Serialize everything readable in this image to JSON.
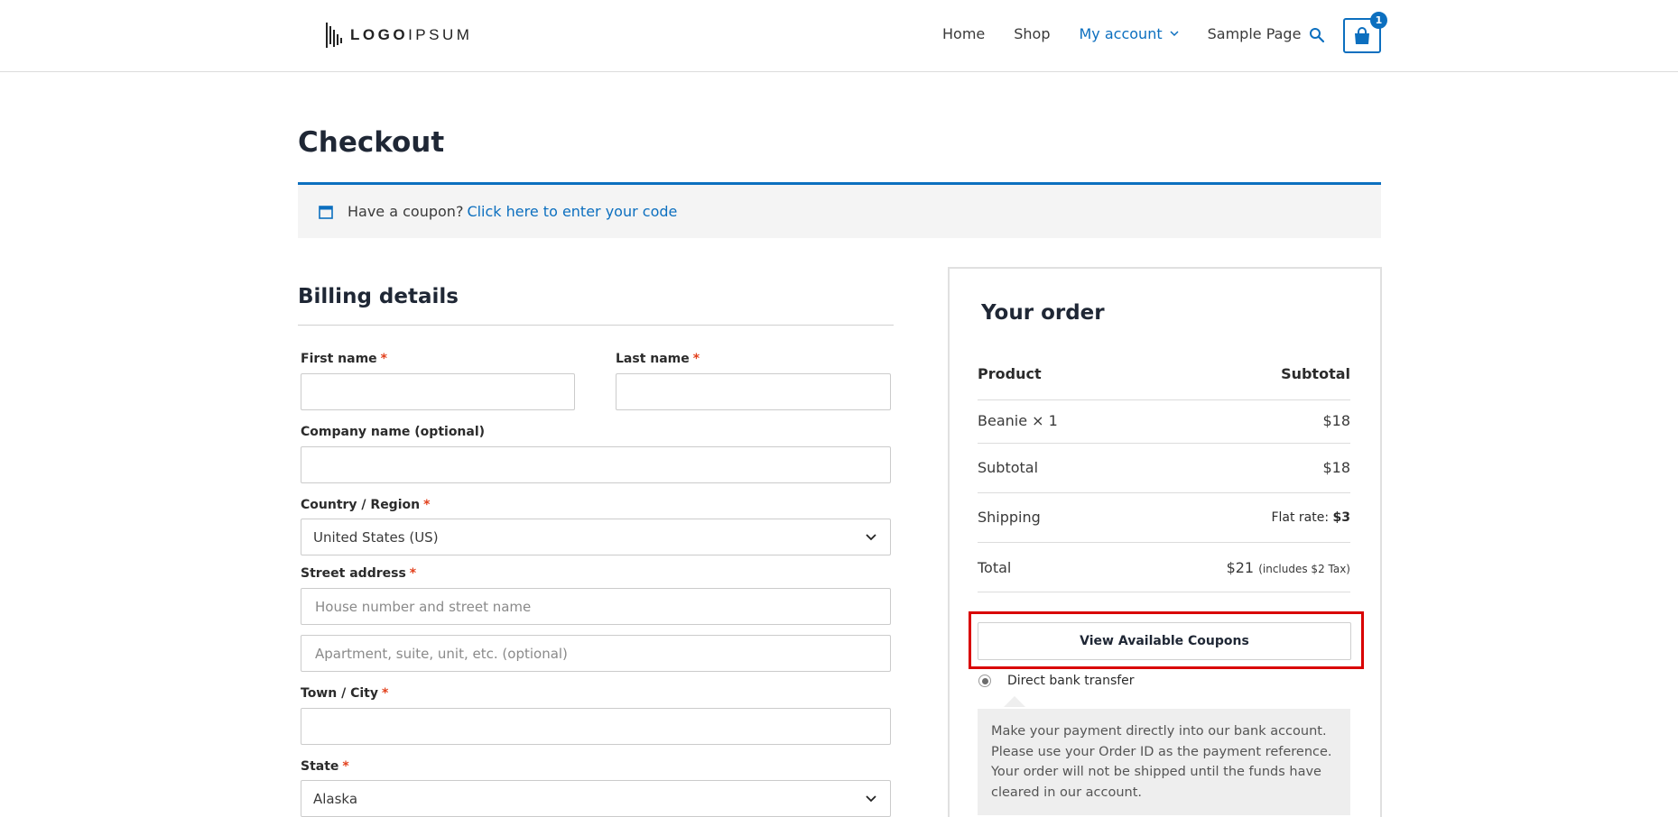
{
  "header": {
    "logo": {
      "bold": "LOGO",
      "light": "IPSUM"
    },
    "nav": [
      {
        "label": "Home"
      },
      {
        "label": "Shop"
      },
      {
        "label": "My account"
      },
      {
        "label": "Sample Page"
      }
    ],
    "cart_count": "1",
    "accent_color": "#0c6fbf"
  },
  "page": {
    "title": "Checkout"
  },
  "coupon_notice": {
    "text": "Have a coupon?",
    "link": "Click here to enter your code"
  },
  "billing": {
    "title": "Billing details",
    "first_name_label": "First name",
    "last_name_label": "Last name",
    "company_label": "Company name (optional)",
    "country_label": "Country / Region",
    "country_value": "United States (US)",
    "street_label": "Street address",
    "street_placeholder": "House number and street name",
    "apartment_placeholder": "Apartment, suite, unit, etc. (optional)",
    "city_label": "Town / City",
    "state_label": "State",
    "state_value": "Alaska",
    "required_mark": "*"
  },
  "order": {
    "title": "Your order",
    "product_header": "Product",
    "subtotal_header": "Subtotal",
    "item_name": "Beanie",
    "item_qty": "× 1",
    "item_price": "$18",
    "subtotal_label": "Subtotal",
    "subtotal_value": "$18",
    "shipping_label": "Shipping",
    "shipping_method": "Flat rate:",
    "shipping_value": "$3",
    "total_label": "Total",
    "total_value": "$21",
    "tax_note": "(includes $2 Tax)",
    "coupons_button": "View Available Coupons",
    "payment_method": "Direct bank transfer",
    "payment_description": "Make your payment directly into our bank account. Please use your Order ID as the payment reference. Your order will not be shipped until the funds have cleared in our account."
  }
}
